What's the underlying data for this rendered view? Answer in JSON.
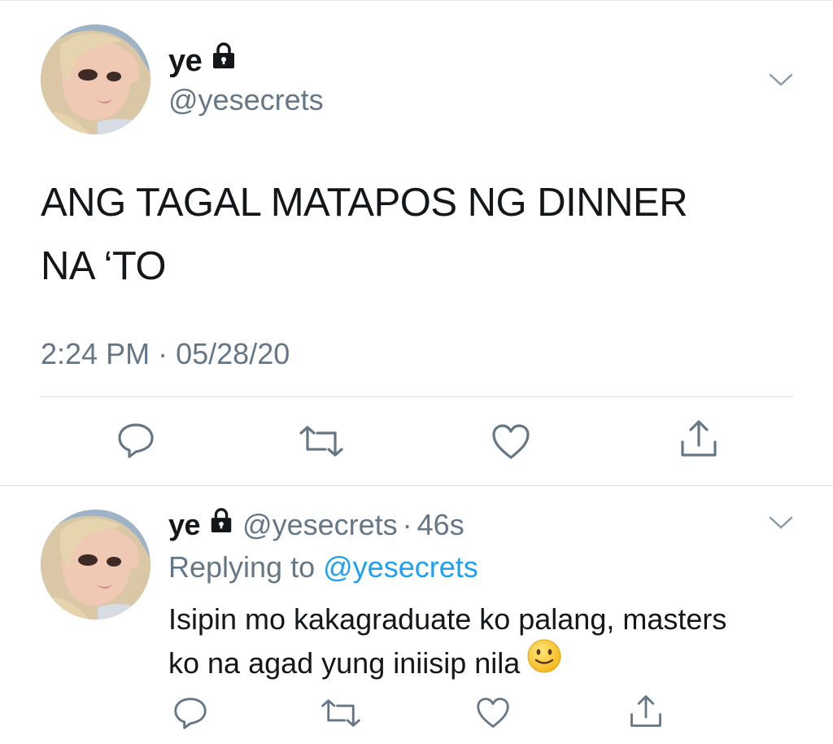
{
  "main_tweet": {
    "name": "ye",
    "handle": "@yesecrets",
    "text_line1": "ANG TAGAL MATAPOS NG DINNER",
    "text_line2": "NA ‘TO",
    "time": "2:24 PM",
    "date_sep": "·",
    "date": "05/28/20",
    "avatar_icon": "avatar-image",
    "lock_icon": "lock-icon"
  },
  "reply": {
    "name": "ye",
    "handle": "@yesecrets",
    "sep": "·",
    "age": "46s",
    "replying_label": "Replying to",
    "replying_handle": "@yesecrets",
    "text_line1": "Isipin mo kakagraduate ko palang, masters",
    "text_line2": "ko na agad yung iniisip nila",
    "emoji_icon": "slightly-smiling-face-icon"
  },
  "actions": [
    "reply-icon",
    "retweet-icon",
    "like-icon",
    "share-icon"
  ],
  "colors": {
    "text": "#14171a",
    "secondary": "#657786",
    "link": "#1da1f2",
    "icon": "#657786",
    "divider": "#d6dde3"
  }
}
